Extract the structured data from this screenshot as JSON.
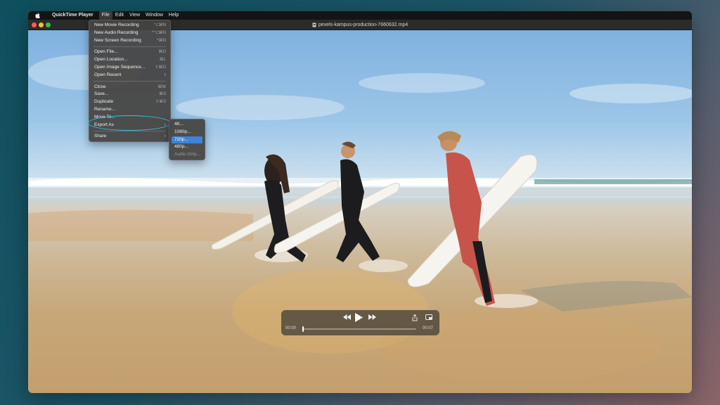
{
  "menubar": {
    "app_name": "QuickTime Player",
    "items": [
      "File",
      "Edit",
      "View",
      "Window",
      "Help"
    ]
  },
  "window": {
    "title": "pexels-kampus-production-7660632.mp4"
  },
  "file_menu": {
    "items": [
      {
        "label": "New Movie Recording",
        "shortcut": "⌥⌘N"
      },
      {
        "label": "New Audio Recording",
        "shortcut": "^⌥⌘N"
      },
      {
        "label": "New Screen Recording",
        "shortcut": "^⌘N"
      },
      {
        "label": "Open File...",
        "shortcut": "⌘O"
      },
      {
        "label": "Open Location...",
        "shortcut": "⌘L"
      },
      {
        "label": "Open Image Sequence...",
        "shortcut": "⇧⌘O"
      },
      {
        "label": "Open Recent",
        "shortcut": ""
      },
      {
        "label": "Close",
        "shortcut": "⌘W"
      },
      {
        "label": "Save...",
        "shortcut": "⌘S"
      },
      {
        "label": "Duplicate",
        "shortcut": "⇧⌘S"
      },
      {
        "label": "Rename...",
        "shortcut": ""
      },
      {
        "label": "Move To...",
        "shortcut": ""
      },
      {
        "label": "Export As",
        "shortcut": ""
      },
      {
        "label": "Share",
        "shortcut": ""
      }
    ]
  },
  "export_submenu": {
    "items": [
      {
        "label": "4K...",
        "state": "enabled"
      },
      {
        "label": "1080p...",
        "state": "enabled"
      },
      {
        "label": "720p...",
        "state": "highlighted"
      },
      {
        "label": "480p...",
        "state": "enabled"
      },
      {
        "label": "Audio Only...",
        "state": "disabled"
      }
    ]
  },
  "controls": {
    "current_time": "00:00",
    "duration": "00:07",
    "progress": 0.0
  },
  "colors": {
    "highlight": "#3f82d6",
    "annotation_ring": "#2fc4e0",
    "traffic_red": "#ff5f57",
    "traffic_yellow": "#febc2e",
    "traffic_green": "#28c840"
  },
  "icons": {
    "apple": "apple-logo-icon",
    "rewind": "rewind-icon",
    "play": "play-icon",
    "fast_forward": "fast-forward-icon",
    "share": "share-icon",
    "pip": "picture-in-picture-icon",
    "document": "movie-file-icon"
  }
}
